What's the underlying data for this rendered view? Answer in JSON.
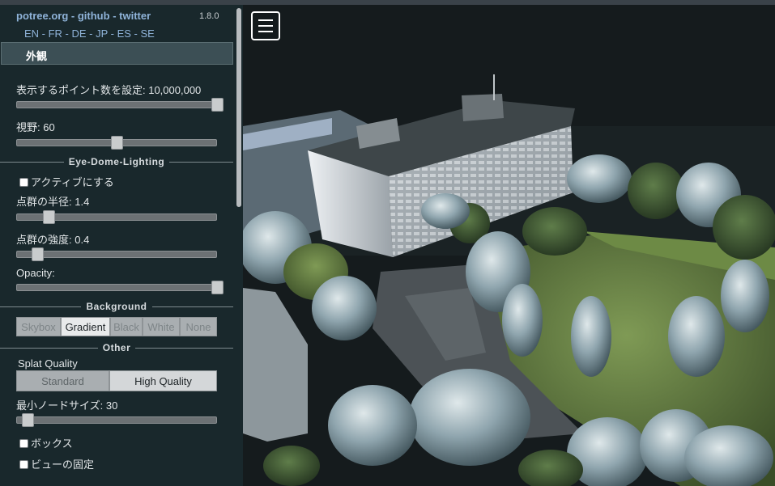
{
  "header": {
    "link_potree": "potree.org",
    "sep1": " - ",
    "link_github": "github",
    "sep2": " - ",
    "link_twitter": "twitter",
    "version": "1.8.0",
    "languages": "EN - FR - DE - JP - ES - SE"
  },
  "section": {
    "title": "外観"
  },
  "appearance": {
    "point_budget_label": "表示するポイント数を設定: 10,000,000",
    "point_budget_value": 10000000,
    "point_budget_fraction": 1.0,
    "fov_label": "視野: 60",
    "fov_value": 60,
    "fov_fraction": 0.5
  },
  "edl": {
    "title": "Eye-Dome-Lighting",
    "enable_label": "アクティブにする",
    "radius_label": "点群の半径: 1.4",
    "radius_value": 1.4,
    "radius_fraction": 0.14,
    "strength_label": "点群の強度: 0.4",
    "strength_value": 0.4,
    "strength_fraction": 0.08,
    "opacity_label": "Opacity:",
    "opacity_fraction": 1.0
  },
  "background": {
    "title": "Background",
    "options": [
      "Skybox",
      "Gradient",
      "Black",
      "White",
      "None"
    ],
    "selected": "Gradient"
  },
  "other": {
    "title": "Other",
    "splat_quality_label": "Splat Quality",
    "splat_options": [
      "Standard",
      "High Quality"
    ],
    "splat_selected": "High Quality",
    "min_node_size_label": "最小ノードサイズ: 30",
    "min_node_size_value": 30,
    "min_node_size_fraction": 0.03,
    "box_label": "ボックス",
    "lock_view_label": "ビューの固定"
  },
  "colors": {
    "sidebar_bg": "#19282c",
    "link": "#8fb3d9",
    "section_header_bg": "#3c4f55"
  },
  "icons": {
    "menu": "hamburger-menu-icon"
  }
}
